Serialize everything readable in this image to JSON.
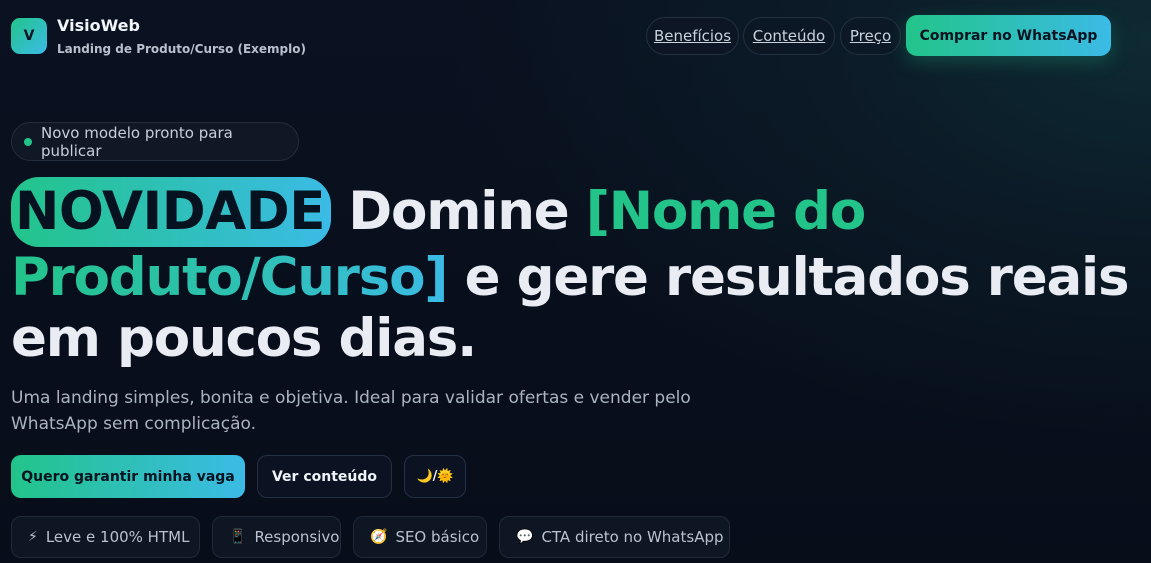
{
  "header": {
    "logo_letter": "V",
    "brand_name": "VisioWeb",
    "brand_subtitle": "Landing de Produto/Curso (Exemplo)",
    "nav": [
      "Benefícios",
      "Conteúdo",
      "Preço"
    ],
    "cta_label": "Comprar no WhatsApp"
  },
  "hero": {
    "pill_text": "Novo modelo pronto para publicar",
    "badge": "NOVIDADE",
    "headline_1": "Domine",
    "headline_highlight_a": "[Nome do",
    "headline_highlight_b": "Produto/Curso]",
    "headline_2": "e gere resultados reais em poucos dias.",
    "subtext": "Uma landing simples, bonita e objetiva. Ideal para validar ofertas e vender pelo WhatsApp sem complicação.",
    "primary_button": "Quero garantir minha vaga",
    "secondary_button": "Ver conteúdo",
    "theme_toggle": "🌙/🌞"
  },
  "features": [
    {
      "icon": "lightning-icon",
      "glyph": "⚡",
      "label": "Leve e 100% HTML"
    },
    {
      "icon": "phone-icon",
      "glyph": "📱",
      "label": "Responsivo"
    },
    {
      "icon": "compass-icon",
      "glyph": "🧭",
      "label": "SEO básico"
    },
    {
      "icon": "chat-icon",
      "glyph": "💬",
      "label": "CTA direto no WhatsApp"
    }
  ],
  "colors": {
    "accent_green": "#22c48a",
    "accent_blue": "#3bbbe6",
    "background": "#0a1120"
  }
}
